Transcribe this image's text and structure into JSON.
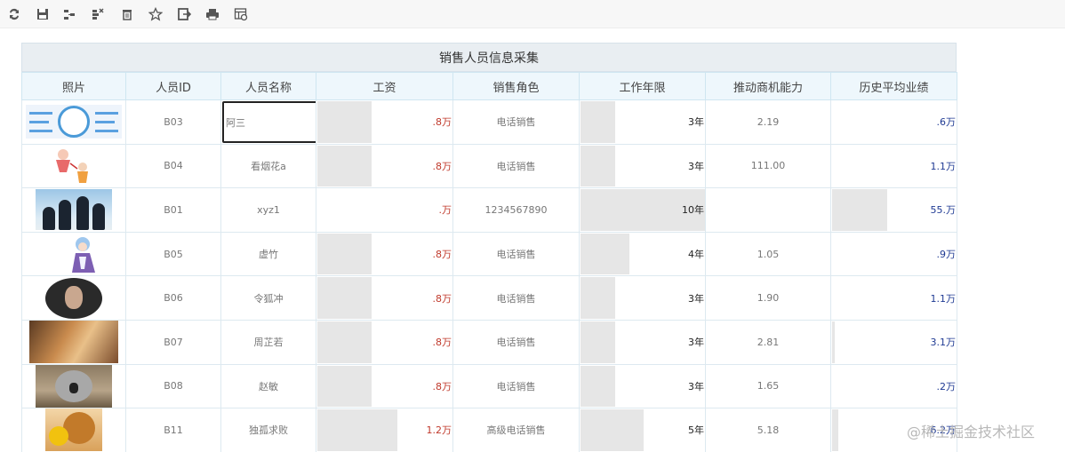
{
  "toolbar": {
    "icons": [
      "refresh-icon",
      "save-icon",
      "indent-icon",
      "outdent-icon",
      "delete-icon",
      "star-icon",
      "export-icon",
      "print-icon",
      "settings-table-icon"
    ]
  },
  "report": {
    "title": "销售人员信息采集",
    "columns": [
      "照片",
      "人员ID",
      "人员名称",
      "工资",
      "销售角色",
      "工作年限",
      "推动商机能力",
      "历史平均业绩"
    ],
    "rows": [
      {
        "photo": "flowchart-image",
        "id": "B03",
        "name": "阿三",
        "salary": ".8万",
        "salary_fill": 0.4,
        "role": "电话销售",
        "years": "3年",
        "years_fill": 0.28,
        "ability": "2.19",
        "perf": ".6万",
        "perf_fill": 0.0
      },
      {
        "photo": "cartoon-image",
        "id": "B04",
        "name": "看烟花a",
        "salary": ".8万",
        "salary_fill": 0.4,
        "role": "电话销售",
        "years": "3年",
        "years_fill": 0.28,
        "ability": "111.00",
        "perf": "1.1万",
        "perf_fill": 0.0
      },
      {
        "photo": "penguin-image",
        "id": "B01",
        "name": "xyz1",
        "salary": ".万",
        "salary_fill": 0.0,
        "role": "1234567890",
        "years": "10年",
        "years_fill": 1.0,
        "ability": "",
        "perf": "55.万",
        "perf_fill": 0.44
      },
      {
        "photo": "anime-image",
        "id": "B05",
        "name": "虚竹",
        "salary": ".8万",
        "salary_fill": 0.4,
        "role": "电话销售",
        "years": "4年",
        "years_fill": 0.39,
        "ability": "1.05",
        "perf": ".9万",
        "perf_fill": 0.0
      },
      {
        "photo": "portrait-image",
        "id": "B06",
        "name": "令狐冲",
        "salary": ".8万",
        "salary_fill": 0.4,
        "role": "电话销售",
        "years": "3年",
        "years_fill": 0.28,
        "ability": "1.90",
        "perf": "1.1万",
        "perf_fill": 0.0
      },
      {
        "photo": "art-image",
        "id": "B07",
        "name": "周芷若",
        "salary": ".8万",
        "salary_fill": 0.4,
        "role": "电话销售",
        "years": "3年",
        "years_fill": 0.28,
        "ability": "2.81",
        "perf": "3.1万",
        "perf_fill": 0.02
      },
      {
        "photo": "koala-image",
        "id": "B08",
        "name": "赵敏",
        "salary": ".8万",
        "salary_fill": 0.4,
        "role": "电话销售",
        "years": "3年",
        "years_fill": 0.28,
        "ability": "1.65",
        "perf": ".2万",
        "perf_fill": 0.0
      },
      {
        "photo": "dog-image",
        "id": "B11",
        "name": "独孤求败",
        "salary": "1.2万",
        "salary_fill": 0.59,
        "role": "高级电话销售",
        "years": "5年",
        "years_fill": 0.5,
        "ability": "5.18",
        "perf": "6.2万",
        "perf_fill": 0.05
      }
    ]
  },
  "watermark": "@稀土掘金技术社区",
  "colors": {
    "salary_text": "#c0392b",
    "perf_text": "#1f3a93",
    "header_bg": "#eef7fc",
    "bar_fill": "#e6e6e6"
  }
}
